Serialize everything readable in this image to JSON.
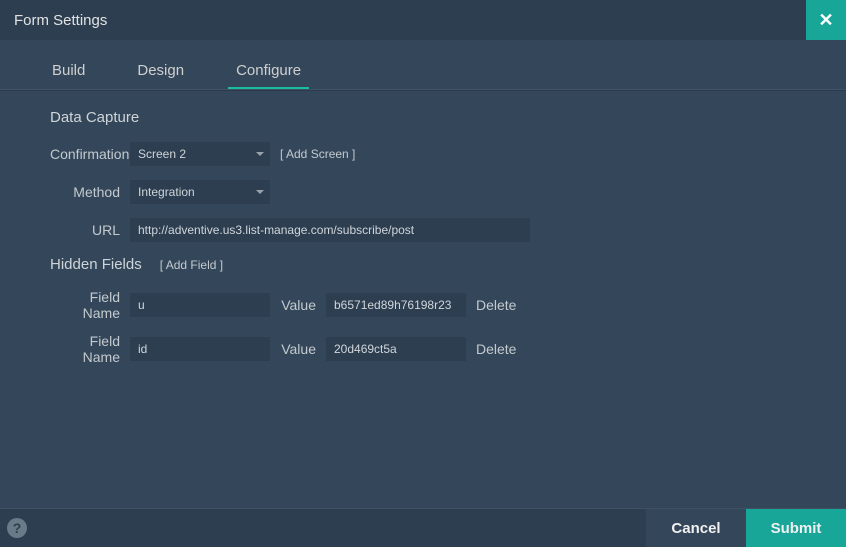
{
  "header": {
    "title": "Form Settings"
  },
  "tabs": {
    "build": "Build",
    "design": "Design",
    "configure": "Configure"
  },
  "section": {
    "data_capture": "Data Capture",
    "hidden_fields": "Hidden Fields"
  },
  "labels": {
    "confirmation": "Confirmation",
    "method": "Method",
    "url": "URL",
    "field_name": "Field Name",
    "value": "Value",
    "delete": "Delete",
    "add_screen": "[ Add Screen ]",
    "add_field": "[ Add Field ]"
  },
  "values": {
    "confirmation_select": "Screen 2",
    "method_select": "Integration",
    "url": "http://adventive.us3.list-manage.com/subscribe/post"
  },
  "hidden_fields": [
    {
      "name": "u",
      "value": "b6571ed89h76198r23"
    },
    {
      "name": "id",
      "value": "20d469ct5a"
    }
  ],
  "footer": {
    "cancel": "Cancel",
    "submit": "Submit",
    "help": "?"
  }
}
